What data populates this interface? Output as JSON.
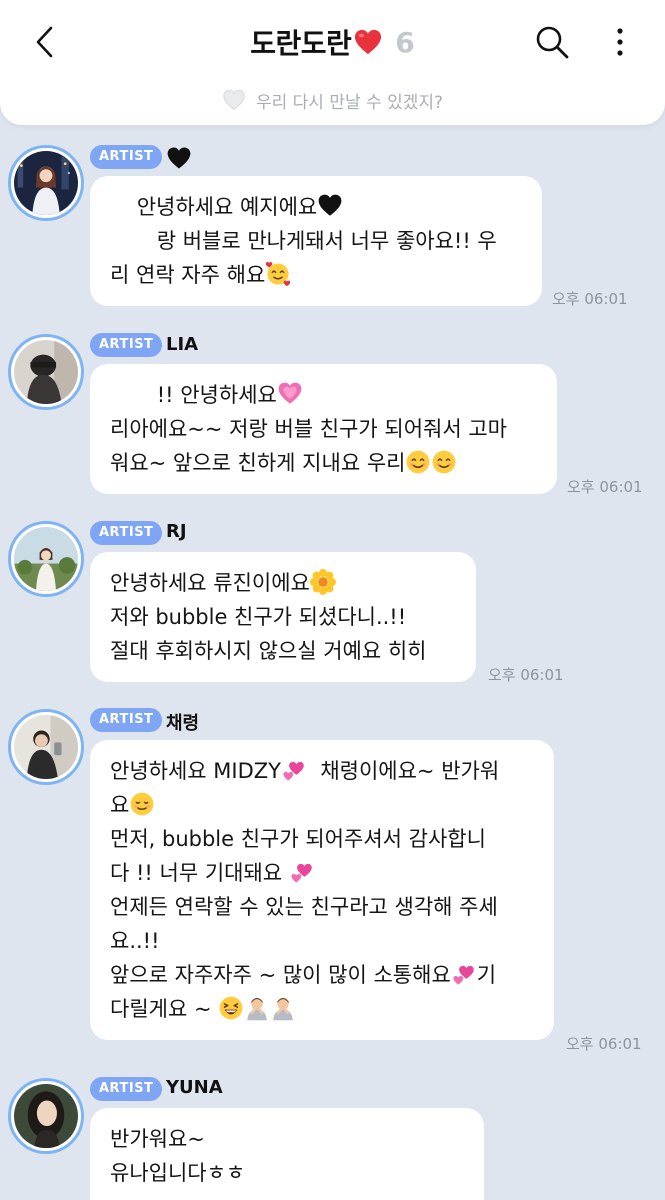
{
  "header": {
    "title": "도란도란",
    "count": "6",
    "subtitle": "우리 다시 만날 수 있겠지?"
  },
  "badge_label": "ARTIST",
  "messages": [
    {
      "sender": "",
      "time": "오후 06:01",
      "lines": [
        {
          "t": "    안녕하세요 예지에요",
          "e": [
            "black-heart"
          ]
        },
        {
          "t": "       랑 버블로 만나게돼서 너무 좋아요!! 우",
          "e": []
        },
        {
          "t": "리 연락 자주 해요",
          "e": [
            "smiling-face-hearts"
          ]
        }
      ]
    },
    {
      "sender": "LIA",
      "time": "오후 06:01",
      "lines": [
        {
          "t": "       !! 안녕하세요",
          "e": [
            "sparkling-heart"
          ]
        },
        {
          "t": "리아에요~~ 저랑 버블 친구가 되어줘서 고마",
          "e": []
        },
        {
          "t": "워요~ 앞으로 친하게 지내요 우리",
          "e": [
            "smile",
            "smile"
          ]
        }
      ]
    },
    {
      "sender": "RJ",
      "time": "오후 06:01",
      "lines": [
        {
          "t": "안녕하세요 류진이에요",
          "e": [
            "blossom"
          ]
        },
        {
          "t": "저와 bubble 친구가 되셨다니..!!",
          "e": []
        },
        {
          "t": "절대 후회하시지 않으실 거예요 히히",
          "e": []
        }
      ]
    },
    {
      "sender": "채령",
      "time": "오후 06:01",
      "lines": [
        {
          "t": "안녕하세요 MIDZY",
          "e": [
            "two-hearts"
          ],
          "after": "  채령이에요~ 반가워"
        },
        {
          "t": "요",
          "e": [
            "relieved"
          ]
        },
        {
          "t": "먼저, bubble 친구가 되어주셔서 감사합니",
          "e": []
        },
        {
          "t": "다 !! 너무 기대돼요 ",
          "e": [
            "two-hearts"
          ]
        },
        {
          "t": "언제든 연락할 수 있는 친구라고 생각해 주세",
          "e": []
        },
        {
          "t": "요..!!",
          "e": []
        },
        {
          "t": "앞으로 자주자주 ~ 많이 많이 소통해요",
          "e": [
            "two-hearts"
          ],
          "after": "기"
        },
        {
          "t": "다릴게요 ~ ",
          "e": [
            "laughing",
            "bow",
            "bow"
          ]
        }
      ]
    },
    {
      "sender": "YUNA",
      "time": "",
      "lines": [
        {
          "t": "반가워요~",
          "e": []
        },
        {
          "t": "유나입니다ㅎㅎ",
          "e": []
        }
      ]
    }
  ]
}
